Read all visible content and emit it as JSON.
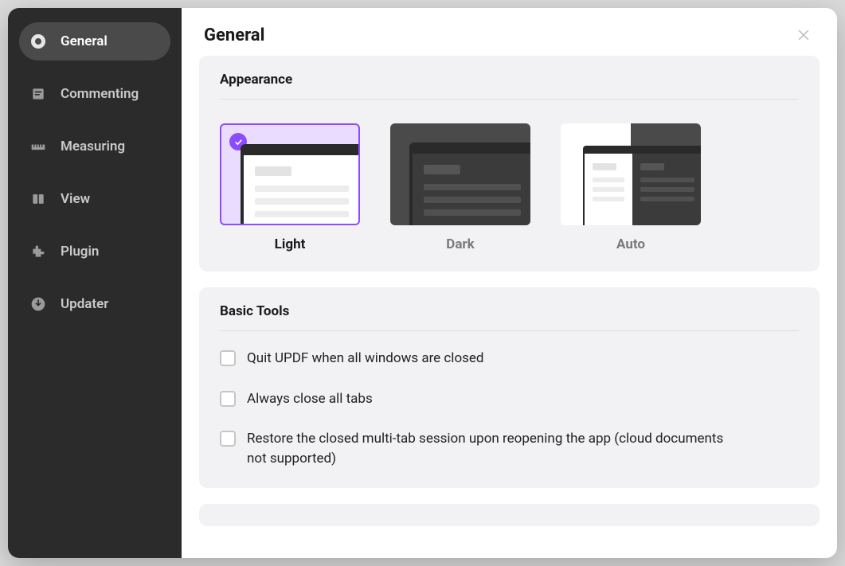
{
  "header": {
    "title": "General"
  },
  "sidebar": {
    "items": [
      {
        "label": "General",
        "active": true
      },
      {
        "label": "Commenting",
        "active": false
      },
      {
        "label": "Measuring",
        "active": false
      },
      {
        "label": "View",
        "active": false
      },
      {
        "label": "Plugin",
        "active": false
      },
      {
        "label": "Updater",
        "active": false
      }
    ]
  },
  "appearance": {
    "section_title": "Appearance",
    "themes": {
      "light": {
        "label": "Light",
        "selected": true
      },
      "dark": {
        "label": "Dark",
        "selected": false
      },
      "auto": {
        "label": "Auto",
        "selected": false
      }
    }
  },
  "basic_tools": {
    "section_title": "Basic Tools",
    "options": [
      {
        "label": "Quit UPDF when all windows are closed",
        "checked": false
      },
      {
        "label": "Always close all tabs",
        "checked": false
      },
      {
        "label": "Restore the closed multi-tab session upon reopening the app (cloud documents not supported)",
        "checked": false
      }
    ]
  },
  "colors": {
    "accent": "#8b4bff"
  }
}
